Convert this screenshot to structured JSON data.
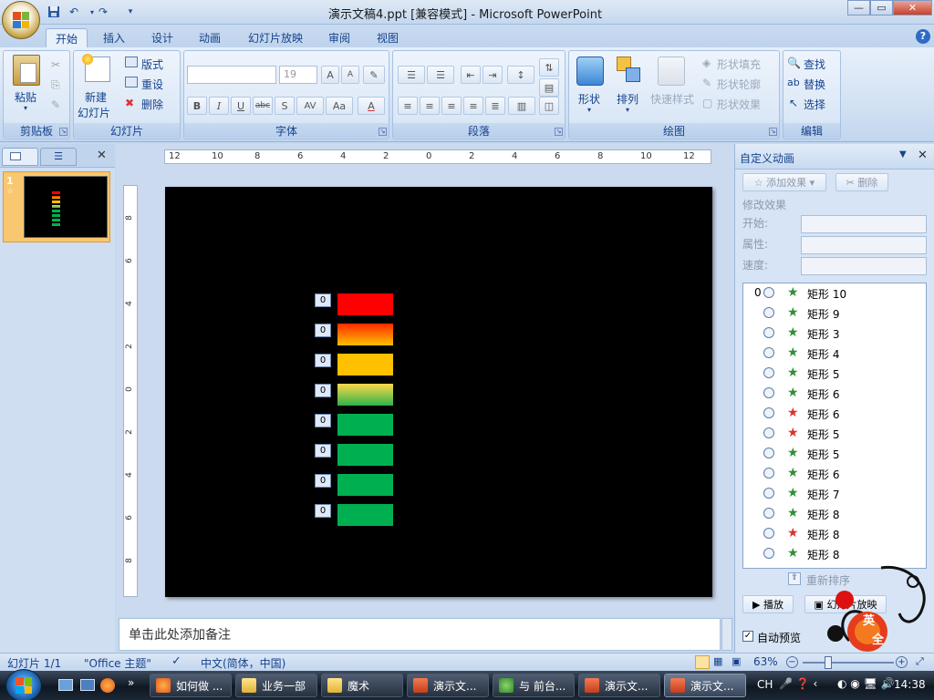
{
  "window": {
    "title": "演示文稿4.ppt [兼容模式] - Microsoft PowerPoint",
    "controls": [
      "minimize",
      "maximize",
      "close"
    ]
  },
  "quick_access": {
    "icons": [
      "save-icon",
      "undo-icon",
      "redo-icon",
      "customize-icon"
    ]
  },
  "ribbon": {
    "tabs": [
      "开始",
      "插入",
      "设计",
      "动画",
      "幻灯片放映",
      "审阅",
      "视图"
    ],
    "active_tab": "开始",
    "clipboard": {
      "paste": "粘贴",
      "label": "剪贴板"
    },
    "slides": {
      "new_slide": "新建\n幻灯片",
      "new_slide_line1": "新建",
      "new_slide_line2": "幻灯片",
      "layout": "版式",
      "reset": "重设",
      "delete": "删除",
      "label": "幻灯片"
    },
    "font": {
      "font_name": "",
      "font_size": "19",
      "label": "字体",
      "bold": "B",
      "italic": "I",
      "underline": "U",
      "strike": "abc",
      "shadow": "S",
      "spacing": "AV",
      "case": "Aa",
      "color": "A",
      "grow": "A",
      "shrink": "A"
    },
    "paragraph": {
      "label": "段落"
    },
    "drawing": {
      "shape": "形状",
      "arrange": "排列",
      "quick_styles": "快速样式",
      "fill": "形状填充",
      "outline": "形状轮廓",
      "effects": "形状效果",
      "label": "绘图"
    },
    "editing": {
      "find": "查找",
      "replace": "替换",
      "select": "选择",
      "label": "编辑"
    }
  },
  "slides_panel": {
    "slide_number": "1",
    "star": "☆"
  },
  "ruler": {
    "h_ticks": [
      "12",
      "10",
      "8",
      "6",
      "4",
      "2",
      "0",
      "2",
      "4",
      "6",
      "8",
      "10",
      "12"
    ],
    "v_ticks": [
      "8",
      "6",
      "4",
      "2",
      "0",
      "2",
      "4",
      "6",
      "8"
    ]
  },
  "slide": {
    "background": "#000000",
    "bars": [
      {
        "tag": "0",
        "color": "#ff0000"
      },
      {
        "tag": "0",
        "color": "gradient-red-yellow"
      },
      {
        "tag": "0",
        "color": "#ffc000"
      },
      {
        "tag": "0",
        "color": "gradient-yellow-green"
      },
      {
        "tag": "0",
        "color": "#00b050"
      },
      {
        "tag": "0",
        "color": "#00b050"
      },
      {
        "tag": "0",
        "color": "#00b050"
      },
      {
        "tag": "0",
        "color": "#00b050"
      }
    ]
  },
  "notes": {
    "placeholder": "单击此处添加备注"
  },
  "task_pane": {
    "title": "自定义动画",
    "add_effect": "添加效果",
    "remove": "删除",
    "modify_label": "修改效果",
    "start_label": "开始:",
    "property_label": "属性:",
    "speed_label": "速度:",
    "animations": [
      {
        "index": "0",
        "name": "矩形 10",
        "type": "entrance"
      },
      {
        "index": "",
        "name": "矩形 9",
        "type": "entrance"
      },
      {
        "index": "",
        "name": "矩形 3",
        "type": "entrance"
      },
      {
        "index": "",
        "name": "矩形 4",
        "type": "entrance"
      },
      {
        "index": "",
        "name": "矩形 5",
        "type": "entrance"
      },
      {
        "index": "",
        "name": "矩形 6",
        "type": "entrance"
      },
      {
        "index": "",
        "name": "矩形 6",
        "type": "exit"
      },
      {
        "index": "",
        "name": "矩形 5",
        "type": "exit"
      },
      {
        "index": "",
        "name": "矩形 5",
        "type": "entrance"
      },
      {
        "index": "",
        "name": "矩形 6",
        "type": "entrance"
      },
      {
        "index": "",
        "name": "矩形 7",
        "type": "entrance"
      },
      {
        "index": "",
        "name": "矩形 8",
        "type": "entrance"
      },
      {
        "index": "",
        "name": "矩形 8",
        "type": "exit"
      },
      {
        "index": "",
        "name": "矩形 8",
        "type": "entrance"
      }
    ],
    "reorder": "重新排序",
    "play": "播放",
    "slideshow": "幻灯片放映",
    "autopreview": "自动预览",
    "decoration_text_1": "英",
    "decoration_text_2": "全"
  },
  "status_bar": {
    "slide_info": "幻灯片 1/1",
    "theme": "\"Office 主题\"",
    "language": "中文(简体，中国)",
    "zoom": "63%"
  },
  "taskbar": {
    "items": [
      {
        "label": "如何做 ...",
        "icon": "firefox-icon"
      },
      {
        "label": "业务一部",
        "icon": "folder-icon"
      },
      {
        "label": "魔术",
        "icon": "folder-icon"
      },
      {
        "label": "演示文...",
        "icon": "powerpoint-icon"
      },
      {
        "label": "与 前台...",
        "icon": "chat-icon"
      },
      {
        "label": "演示文...",
        "icon": "powerpoint-icon"
      },
      {
        "label": "演示文...",
        "icon": "powerpoint-icon"
      }
    ],
    "lang": "CH",
    "time": "14:38"
  },
  "colors": {
    "ribbon_text": "#15428b",
    "slide_bg": "#000000",
    "entrance_star": "#2f8f3a",
    "exit_star": "#d9342b"
  }
}
